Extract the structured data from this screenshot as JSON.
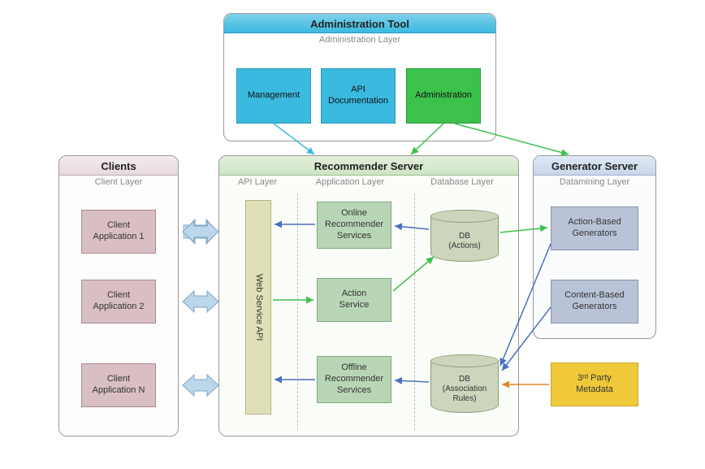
{
  "admin": {
    "title": "Administration Tool",
    "layer": "Administration Layer",
    "boxes": {
      "mgmt": "Management",
      "apidoc": "API\nDocumentation",
      "admin": "Administration"
    }
  },
  "clients": {
    "title": "Clients",
    "layer": "Client Layer",
    "apps": [
      "Client\nApplication 1",
      "Client\nApplication 2",
      "Client\nApplication N"
    ]
  },
  "recommender": {
    "title": "Recommender Server",
    "layers": {
      "api": "API Layer",
      "app": "Application Layer",
      "db": "Database Layer"
    },
    "api_box": "Web Service API",
    "services": {
      "online": "Online\nRecommender\nServices",
      "action": "Action\nService",
      "offline": "Offline\nRecommender\nServices"
    },
    "dbs": {
      "actions": "DB\n(Actions)",
      "rules": "DB\n(Association\nRules)"
    }
  },
  "generator": {
    "title": "Generator Server",
    "layer": "Datamining Layer",
    "boxes": {
      "action": "Action-Based\nGenerators",
      "content": "Content-Based\nGenerators"
    }
  },
  "third_party": "3ʳᵈ Party\nMetadata"
}
